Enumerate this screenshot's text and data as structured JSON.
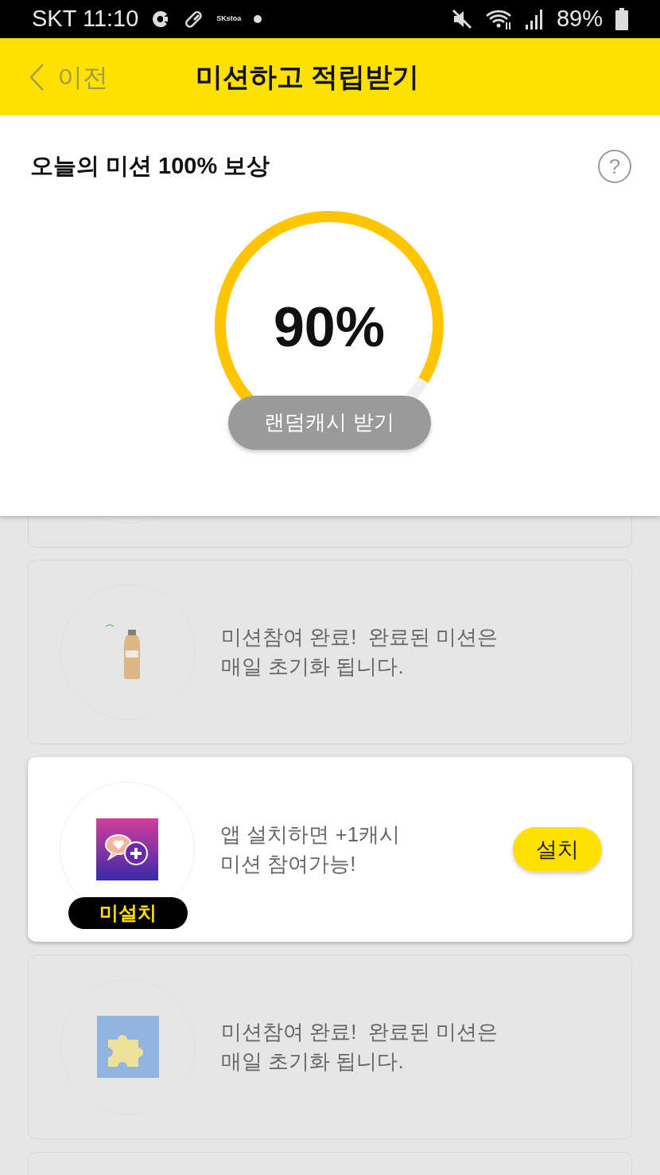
{
  "status_bar": {
    "carrier_time": "SKT 11:10",
    "app_label": "SKstoa",
    "battery": "89%"
  },
  "header": {
    "back": "이전",
    "title": "미션하고 적립받기"
  },
  "reward": {
    "title": "오늘의 미션 100% 보상",
    "help": "?",
    "percent": "90%",
    "button": "랜덤캐시 받기"
  },
  "missions": [
    {
      "kind": "completed",
      "text": "미션참여 완료!  완료된 미션은\n매일 초기화 됩니다."
    },
    {
      "kind": "install",
      "badge": "미설치",
      "text": "앱 설치하면 +1캐시\n미션 참여가능!",
      "button": "설치"
    },
    {
      "kind": "completed",
      "text": "미션참여 완료!  완료된 미션은\n매일 초기화 됩니다."
    }
  ]
}
